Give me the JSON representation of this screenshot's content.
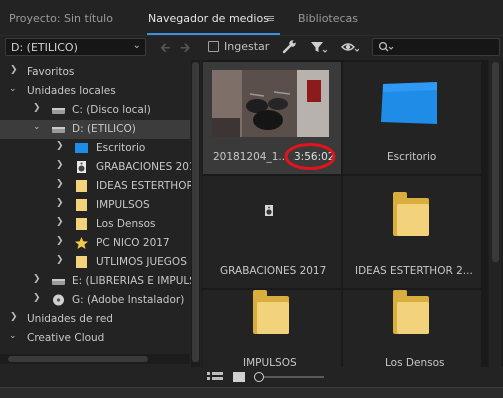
{
  "tabs": {
    "project": "Proyecto: Sin título",
    "media_browser": "Navegador de medios",
    "libraries": "Bibliotecas"
  },
  "toolbar": {
    "drive": "D: (ETILICO)",
    "ingest_label": "Ingestar",
    "ingest_checked": false
  },
  "tree": {
    "favorites": "Favoritos",
    "local_drives": "Unidades locales",
    "drive_c": "C: (Disco local)",
    "drive_d": "D: (ETILICO)",
    "desktop": "Escritorio",
    "recordings": "GRABACIONES 201",
    "ideas": "IDEAS ESTERTHOR",
    "impulses": "IMPULSOS",
    "densos": "Los Densos",
    "pc_nico": "PC NICO 2017",
    "ultimos": "UTLIMOS JUEGOS",
    "drive_e": "E: (LIBRERIAS E IMPULS",
    "drive_g": "G: (Adobe Instalador)",
    "network": "Unidades de red",
    "creative_cloud": "Creative Cloud"
  },
  "media": {
    "video_name": "20181204_1...",
    "video_duration": "3:56:02",
    "desktop": "Escritorio",
    "recordings": "GRABACIONES 2017",
    "ideas": "IDEAS ESTERTHOR 2...",
    "impulses": "IMPULSOS",
    "densos": "Los Densos"
  },
  "colors": {
    "accent": "#3d8fe2",
    "annotation": "#e0141e",
    "folder": "#f2d27a"
  }
}
